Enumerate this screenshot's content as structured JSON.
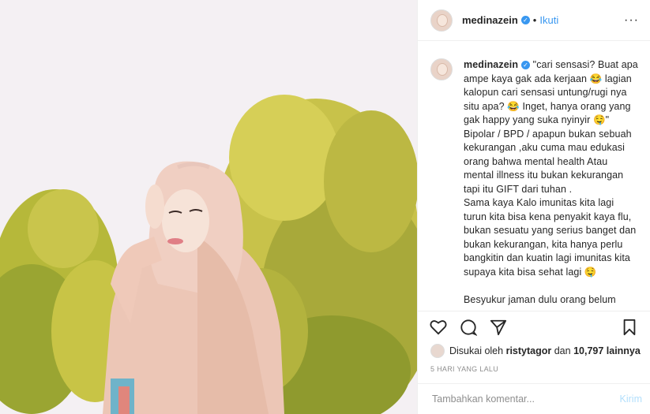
{
  "header": {
    "username": "medinazein",
    "separator": "•",
    "follow_label": "Ikuti",
    "more_label": "···"
  },
  "caption": {
    "username": "medinazein",
    "text": "\"cari sensasi? Buat apa ampe kaya gak ada kerjaan 😂 lagian kalopun cari sensasi untung/rugi nya situ apa? 😂 Inget, hanya orang yang gak happy yang suka nyinyir 🤤\" Bipolar / BPD / apapun bukan sebuah kekurangan ,aku cuma mau edukasi orang bahwa mental health Atau mental illness itu bukan kekurangan tapi itu GIFT dari tuhan .\nSama kaya Kalo imunitas kita lagi turun kita bisa kena penyakit kaya flu, bukan sesuatu yang serius banget dan bukan kekurangan, kita hanya perlu bangkitin dan kuatin lagi imunitas kita supaya kita bisa sehat lagi 🤤\n\nBesyukur jaman dulu orang belum"
  },
  "likes": {
    "prefix": "Disukai oleh",
    "user": "ristytagor",
    "middle": "dan",
    "count": "10,797 lainnya"
  },
  "time_ago": "5 HARI YANG LALU",
  "comment_box": {
    "placeholder": "Tambahkan komentar...",
    "post_label": "Kirim"
  },
  "colors": {
    "accent": "#3897f0",
    "post_disabled": "#b2dffc",
    "meta_gray": "#8e8e8e"
  }
}
